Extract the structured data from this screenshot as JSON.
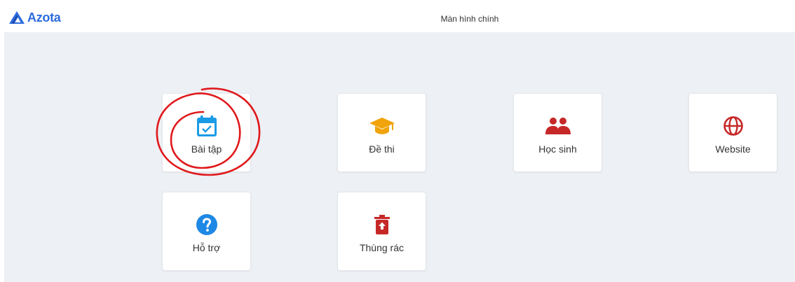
{
  "app": {
    "logo_text": "Azota",
    "page_title": "Màn hình chính"
  },
  "colors": {
    "brand": "#2d6cdf",
    "background": "#edf0f5",
    "assignment_icon": "#1a9be6",
    "exam_icon": "#f0a30a",
    "students_icon": "#c62828",
    "website_icon": "#c62828",
    "support_icon": "#1e88e5",
    "trash_icon": "#c62828",
    "annotation": "#e0181b"
  },
  "tiles": [
    {
      "label": "Bài tập",
      "icon": "calendar-check-icon"
    },
    {
      "label": "Đề thi",
      "icon": "graduation-cap-icon"
    },
    {
      "label": "Học sinh",
      "icon": "users-icon"
    },
    {
      "label": "Website",
      "icon": "globe-icon"
    },
    {
      "label": "Hỗ trợ",
      "icon": "question-circle-icon"
    },
    {
      "label": "Thùng rác",
      "icon": "trash-restore-icon"
    }
  ]
}
